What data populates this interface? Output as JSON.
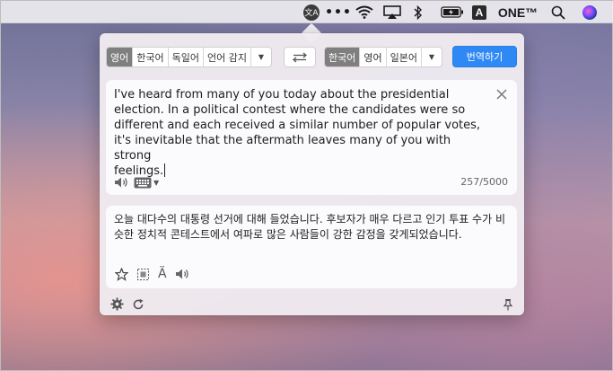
{
  "menubar": {
    "items": [
      {
        "name": "translator",
        "icon": "translate-icon",
        "glyph": "文A"
      },
      {
        "name": "more",
        "icon": "more-dots-icon",
        "glyph": "•••"
      },
      {
        "name": "wifi",
        "icon": "wifi-icon"
      },
      {
        "name": "airplay",
        "icon": "airplay-icon"
      },
      {
        "name": "bluetooth",
        "icon": "bluetooth-icon"
      },
      {
        "name": "battery",
        "icon": "battery-icon"
      },
      {
        "name": "input",
        "icon": "input-source-icon",
        "glyph": "A"
      },
      {
        "name": "one",
        "icon": "one-logo-icon"
      },
      {
        "name": "spotlight",
        "icon": "search-icon"
      },
      {
        "name": "siri",
        "icon": "siri-icon"
      }
    ],
    "input_source_label": "A",
    "brand_label": "ONE™"
  },
  "translator": {
    "source_languages": [
      "영어",
      "한국어",
      "독일어",
      "언어 감지"
    ],
    "source_active_index": 0,
    "target_languages": [
      "한국어",
      "영어",
      "일본어"
    ],
    "target_active_index": 0,
    "translate_button": "번역하기",
    "source_text": "I've heard from many of you today about the presidential\nelection. In a political contest where the candidates were so\ndifferent and each received a similar number of popular votes,\nit's inevitable that the aftermath leaves many of you with strong\nfeelings.",
    "char_count": "257/5000",
    "output_text": "오늘 대다수의 대통령 선거에 대해 들었습니다. 후보자가 매우 다르고 인기 투표 수가 비슷한 정치적 콘테스트에서 여파로 많은 사람들이 강한 감정을 갖게되었습니다."
  },
  "colors": {
    "accent": "#2f89f5",
    "active_lang_bg": "#7f7f7f"
  }
}
